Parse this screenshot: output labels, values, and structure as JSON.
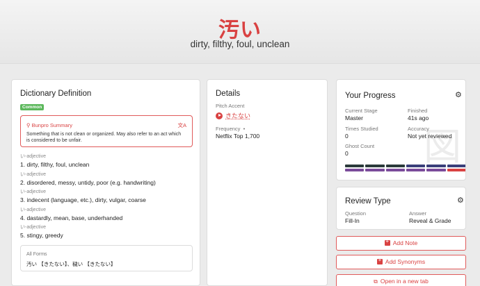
{
  "hero": {
    "kanji": "汚い",
    "meaning": "dirty, filthy, foul, unclean"
  },
  "dictionary": {
    "title": "Dictionary Definition",
    "badge": "Common",
    "summary_title": "Bunpro Summary",
    "summary_text": "Something that is not clean or organized. May also refer to an act which is considered to be unfair.",
    "definitions": [
      {
        "pos": "い-adjective",
        "text": "1.  dirty, filthy, foul, unclean"
      },
      {
        "pos": "い-adjective",
        "text": "2.  disordered, messy, untidy, poor (e.g. handwriting)"
      },
      {
        "pos": "い-adjective",
        "text": "3.  indecent (language, etc.), dirty, vulgar, coarse"
      },
      {
        "pos": "い-adjective",
        "text": "4.  dastardly, mean, base, underhanded"
      },
      {
        "pos": "い-adjective",
        "text": "5.  stingy, greedy"
      }
    ],
    "forms_label": "All Forms",
    "forms_text": "汚い 【きたない】、穢い 【きたない】"
  },
  "details": {
    "title": "Details",
    "pitch_label": "Pitch Accent",
    "reading": "きたない",
    "freq_label": "Frequency",
    "freq_value": "Netflix Top 1,700"
  },
  "progress": {
    "title": "Your Progress",
    "current_stage_label": "Current Stage",
    "current_stage": "Master",
    "finished_label": "Finished",
    "finished": "41s ago",
    "times_studied_label": "Times Studied",
    "times_studied": "0",
    "accuracy_label": "Accuracy",
    "accuracy": "Not yet reviewed",
    "ghost_label": "Ghost Count",
    "ghost": "0",
    "watermark": "図"
  },
  "review": {
    "title": "Review Type",
    "question_label": "Question",
    "question": "Fill-In",
    "answer_label": "Answer",
    "answer": "Reveal & Grade"
  },
  "actions": {
    "add_note": "Add Note",
    "add_synonyms": "Add Synonyms",
    "open_tab": "Open in a new tab"
  },
  "colors": {
    "accent": "#d94242",
    "badge": "#5cb85c"
  }
}
